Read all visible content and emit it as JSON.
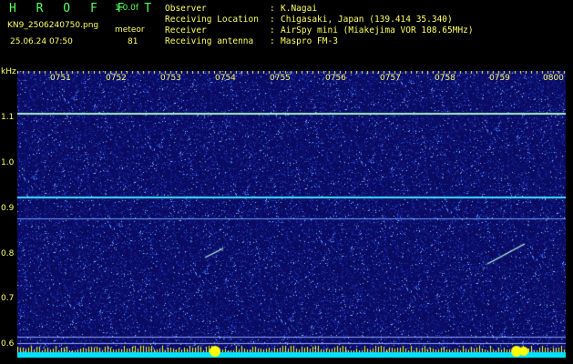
{
  "header": {
    "app_title": "H R O F F T",
    "version": "1.0.0f",
    "filename": "KN9_2506240750.png",
    "datetime": "25.06.24 07:50",
    "meteor_label": "meteor",
    "meteor_count": "81"
  },
  "info": [
    {
      "label": "Observer",
      "value": "K.Nagai"
    },
    {
      "label": "Receiving Location",
      "value": "Chigasaki, Japan (139.414 35.340)"
    },
    {
      "label": "Receiver",
      "value": "AirSpy mini (Miakejima VOR 108.65MHz)"
    },
    {
      "label": "Receiving antenna",
      "value": "Maspro FM-3"
    }
  ],
  "info_separator": ":",
  "axis": {
    "unit": "kHz",
    "y_ticks": [
      "1.1",
      "1.0",
      "0.9",
      "0.8",
      "0.7",
      "0.6"
    ],
    "time_ticks": [
      "0751",
      "0752",
      "0753",
      "0754",
      "0755",
      "0756",
      "0757",
      "0758",
      "0759",
      "0800"
    ]
  },
  "colors": {
    "title_green": "#5cff5c",
    "label_yellow": "#ffff66",
    "spectrogram_bg": "#0a0a60",
    "signal_cyan": "#40e0ff"
  }
}
